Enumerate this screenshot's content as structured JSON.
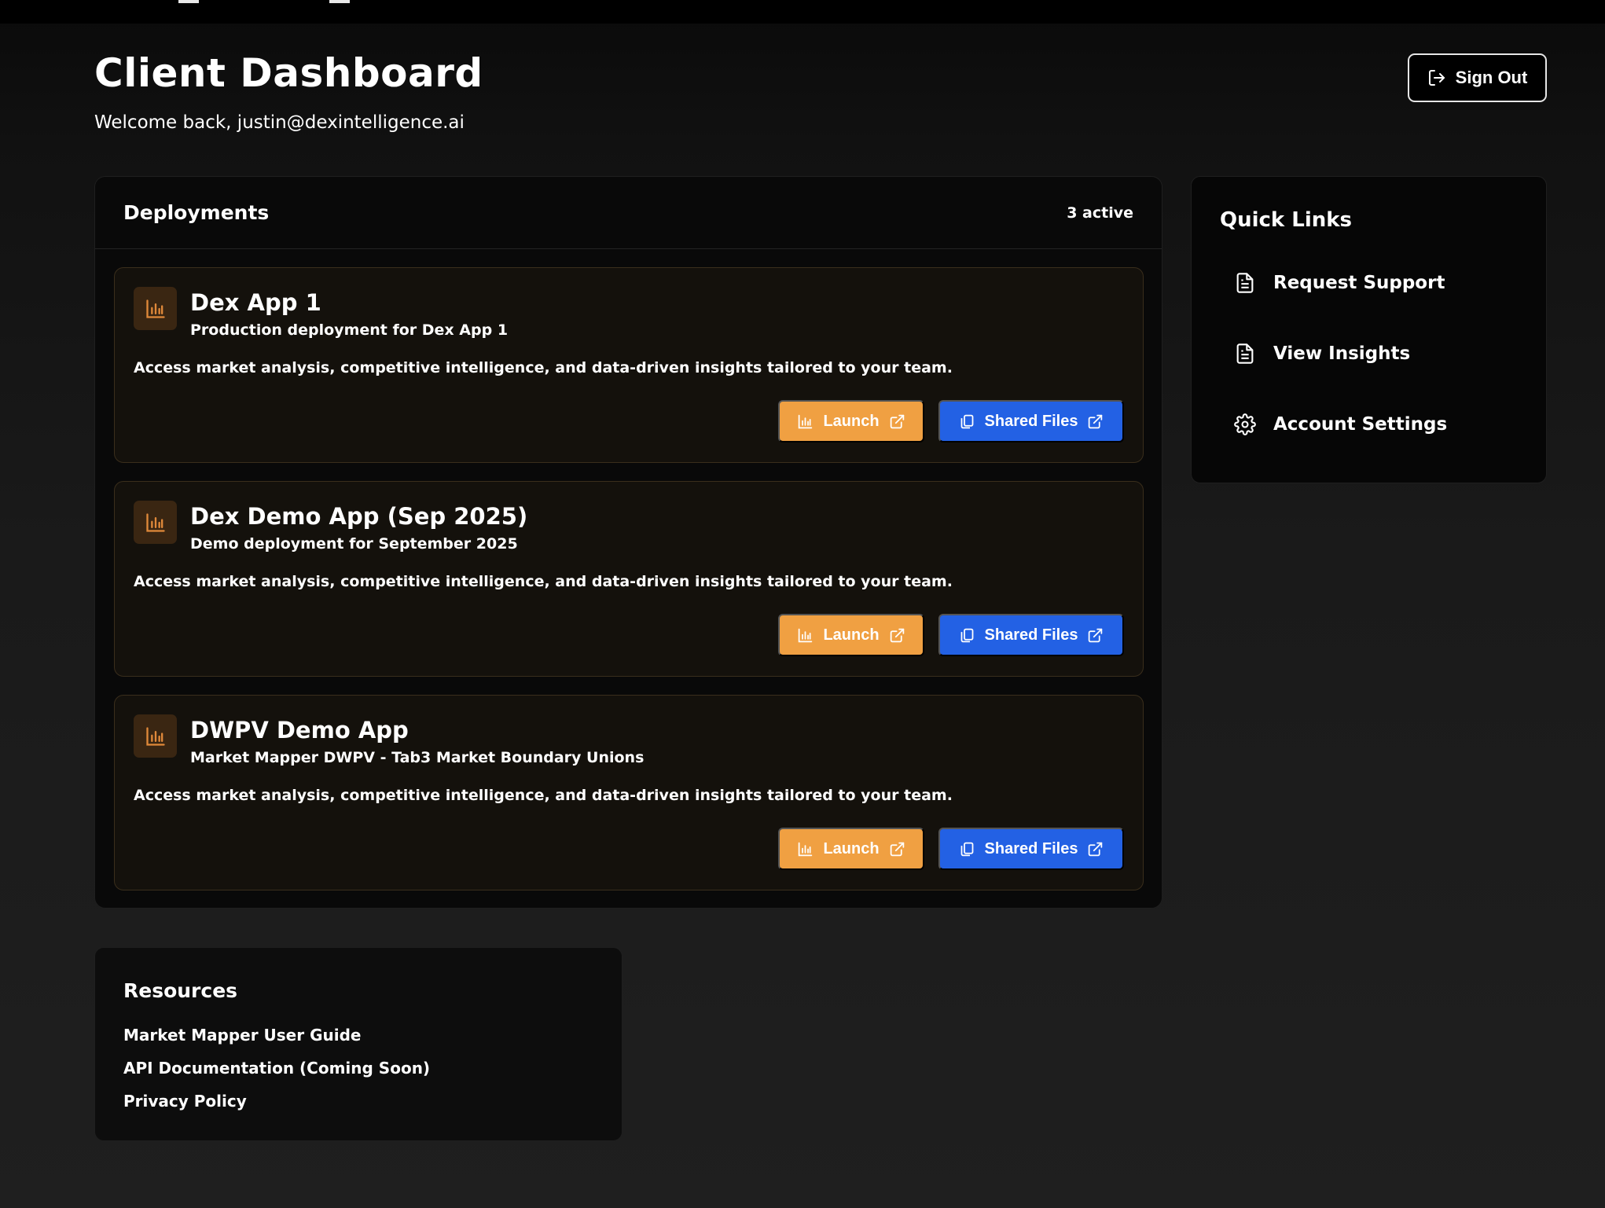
{
  "header": {
    "title": "Client Dashboard",
    "welcome": "Welcome back, justin@dexintelligence.ai",
    "sign_out_label": "Sign Out"
  },
  "deployments": {
    "title": "Deployments",
    "active_count": "3 active",
    "launch_label": "Launch",
    "shared_files_label": "Shared Files",
    "items": [
      {
        "title": "Dex App 1",
        "subtitle": "Production deployment for Dex App 1",
        "description": "Access market analysis, competitive intelligence, and data-driven insights tailored to your team."
      },
      {
        "title": "Dex Demo App (Sep 2025)",
        "subtitle": "Demo deployment for September 2025",
        "description": "Access market analysis, competitive intelligence, and data-driven insights tailored to your team."
      },
      {
        "title": "DWPV Demo App",
        "subtitle": "Market Mapper DWPV - Tab3 Market Boundary Unions",
        "description": "Access market analysis, competitive intelligence, and data-driven insights tailored to your team."
      }
    ]
  },
  "quick_links": {
    "title": "Quick Links",
    "items": [
      {
        "label": "Request Support",
        "icon": "document-icon"
      },
      {
        "label": "View Insights",
        "icon": "document-icon"
      },
      {
        "label": "Account Settings",
        "icon": "gear-icon"
      }
    ]
  },
  "resources": {
    "title": "Resources",
    "items": [
      "Market Mapper User Guide",
      "API Documentation (Coming Soon)",
      "Privacy Policy"
    ]
  },
  "colors": {
    "launch_button": "#f0a042",
    "shared_files_button": "#2361e4",
    "card_accent_icon": "#e0893a"
  }
}
